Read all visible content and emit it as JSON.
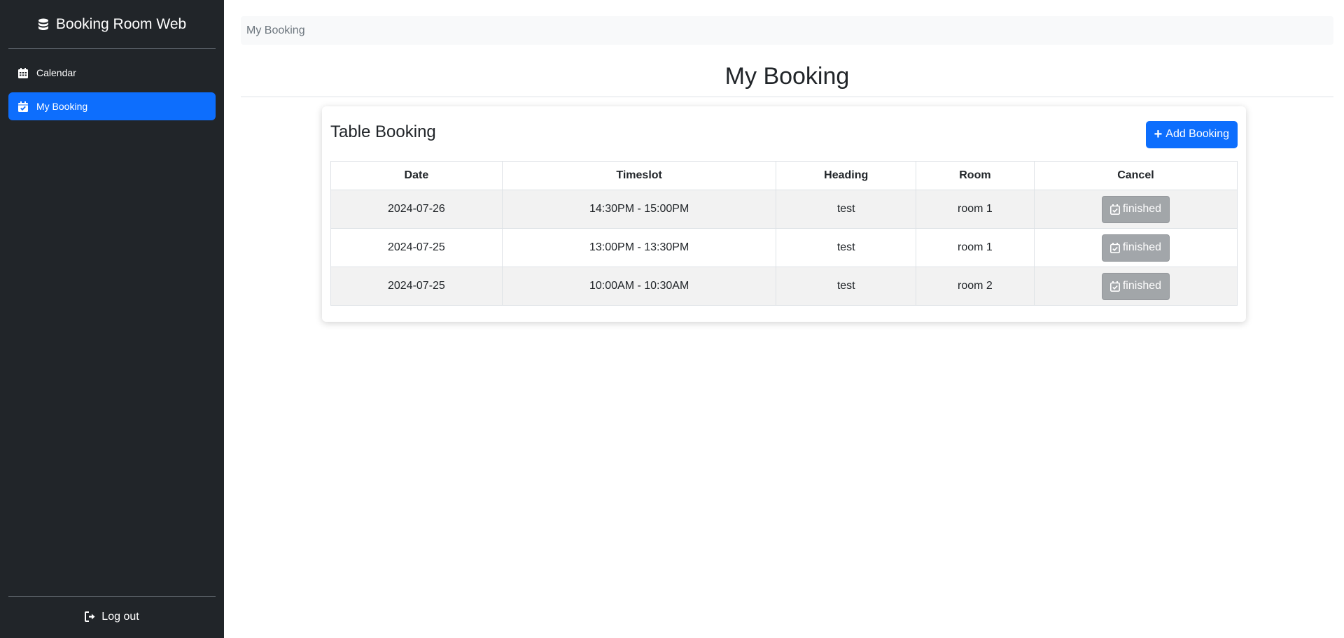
{
  "sidebar": {
    "brand_title": "Booking Room Web",
    "nav": [
      {
        "label": "Calendar",
        "icon": "calendar-icon",
        "active": false
      },
      {
        "label": "My Booking",
        "icon": "calendar-check-icon",
        "active": true
      }
    ],
    "logout_label": "Log out"
  },
  "breadcrumb": "My Booking",
  "page_title": "My Booking",
  "card": {
    "title": "Table Booking",
    "add_button": "Add Booking",
    "columns": [
      "Date",
      "Timeslot",
      "Heading",
      "Room",
      "Cancel"
    ],
    "rows": [
      {
        "date": "2024-07-26",
        "timeslot": "14:30PM - 15:00PM",
        "heading": "test",
        "room": "room 1",
        "status": "finished"
      },
      {
        "date": "2024-07-25",
        "timeslot": "13:00PM - 13:30PM",
        "heading": "test",
        "room": "room 1",
        "status": "finished"
      },
      {
        "date": "2024-07-25",
        "timeslot": "10:00AM - 10:30AM",
        "heading": "test",
        "room": "room 2",
        "status": "finished"
      }
    ]
  },
  "colors": {
    "sidebar_bg": "#212529",
    "accent": "#0d6efd",
    "finished_button": "#9ea2a6"
  }
}
